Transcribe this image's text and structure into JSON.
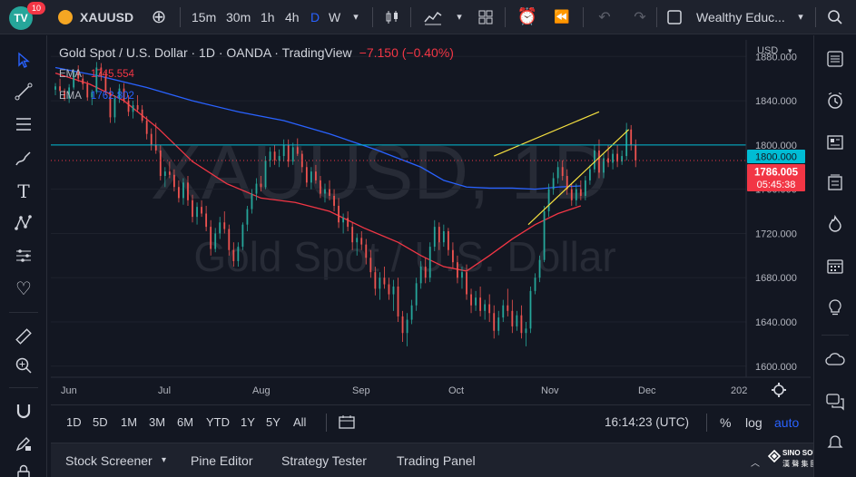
{
  "topbar": {
    "notif_count": "10",
    "symbol": "XAUUSD",
    "timeframes": [
      "15m",
      "30m",
      "1h",
      "4h",
      "D",
      "W"
    ],
    "active_timeframe": "D",
    "account": "Wealthy Educ..."
  },
  "legend": {
    "title": "Gold Spot / U.S. Dollar · 1D · OANDA · TradingView",
    "change": "−7.150 (−0.40%)",
    "ema1_label": "EMA",
    "ema1_value": "1745.554",
    "ema2_label": "EMA",
    "ema2_value": "1762.802"
  },
  "watermark": {
    "symbol": "XAUUSD, 1D",
    "name": "Gold Spot / U.S. Dollar"
  },
  "axis": {
    "currency": "USD",
    "price_ticks": [
      "1880.000",
      "1840.000",
      "1800.000",
      "1760.000",
      "1720.000",
      "1680.000",
      "1640.000",
      "1600.000"
    ],
    "date_ticks": [
      "Jun",
      "Jul",
      "Aug",
      "Sep",
      "Oct",
      "Nov",
      "Dec",
      "202"
    ],
    "level_label": "1800.000",
    "last_price": "1786.005",
    "countdown": "05:45:38"
  },
  "chart_data": {
    "type": "candlestick",
    "x_range": [
      "Jun",
      "Dec"
    ],
    "ylim": [
      1590,
      1895
    ],
    "horizontal_level": 1800,
    "last_price": 1786.005,
    "series": [
      {
        "name": "EMA 1745.554",
        "color": "#f23645",
        "points": [
          [
            0,
            1865
          ],
          [
            15,
            1855
          ],
          [
            30,
            1840
          ],
          [
            45,
            1815
          ],
          [
            60,
            1785
          ],
          [
            75,
            1765
          ],
          [
            90,
            1752
          ],
          [
            105,
            1748
          ],
          [
            120,
            1740
          ],
          [
            135,
            1725
          ],
          [
            150,
            1712
          ],
          [
            160,
            1700
          ],
          [
            170,
            1690
          ],
          [
            180,
            1686
          ],
          [
            190,
            1700
          ],
          [
            200,
            1715
          ],
          [
            210,
            1728
          ],
          [
            220,
            1738
          ],
          [
            230,
            1745
          ]
        ]
      },
      {
        "name": "EMA 1762.802",
        "color": "#2962ff",
        "points": [
          [
            0,
            1870
          ],
          [
            20,
            1862
          ],
          [
            40,
            1852
          ],
          [
            60,
            1840
          ],
          [
            80,
            1830
          ],
          [
            100,
            1822
          ],
          [
            120,
            1810
          ],
          [
            140,
            1796
          ],
          [
            160,
            1780
          ],
          [
            170,
            1768
          ],
          [
            180,
            1762
          ],
          [
            190,
            1761
          ],
          [
            200,
            1761
          ],
          [
            210,
            1760
          ],
          [
            220,
            1762
          ],
          [
            230,
            1763
          ]
        ]
      },
      {
        "name": "trend_upper",
        "color": "#f5e040",
        "points": [
          [
            192,
            1790
          ],
          [
            238,
            1830
          ]
        ]
      },
      {
        "name": "trend_lower",
        "color": "#f5e040",
        "points": [
          [
            207,
            1728
          ],
          [
            251,
            1814
          ]
        ]
      }
    ],
    "candles": [
      [
        0,
        1850,
        1856,
        1845,
        1853
      ],
      [
        2,
        1853,
        1860,
        1848,
        1849
      ],
      [
        4,
        1849,
        1851,
        1840,
        1842
      ],
      [
        6,
        1842,
        1855,
        1838,
        1852
      ],
      [
        8,
        1852,
        1868,
        1850,
        1866
      ],
      [
        10,
        1866,
        1872,
        1857,
        1860
      ],
      [
        12,
        1860,
        1864,
        1850,
        1855
      ],
      [
        14,
        1855,
        1858,
        1840,
        1843
      ],
      [
        16,
        1843,
        1850,
        1836,
        1848
      ],
      [
        18,
        1848,
        1875,
        1846,
        1870
      ],
      [
        20,
        1870,
        1874,
        1858,
        1862
      ],
      [
        22,
        1862,
        1866,
        1845,
        1848
      ],
      [
        24,
        1848,
        1852,
        1820,
        1825
      ],
      [
        26,
        1825,
        1845,
        1820,
        1842
      ],
      [
        28,
        1842,
        1855,
        1838,
        1851
      ],
      [
        30,
        1851,
        1856,
        1838,
        1840
      ],
      [
        32,
        1840,
        1845,
        1826,
        1830
      ],
      [
        34,
        1830,
        1840,
        1824,
        1836
      ],
      [
        36,
        1836,
        1845,
        1830,
        1832
      ],
      [
        38,
        1832,
        1836,
        1820,
        1822
      ],
      [
        40,
        1822,
        1826,
        1805,
        1810
      ],
      [
        42,
        1810,
        1815,
        1795,
        1800
      ],
      [
        44,
        1800,
        1820,
        1792,
        1795
      ],
      [
        46,
        1795,
        1800,
        1768,
        1772
      ],
      [
        48,
        1772,
        1780,
        1762,
        1776
      ],
      [
        50,
        1776,
        1785,
        1770,
        1773
      ],
      [
        52,
        1773,
        1778,
        1758,
        1762
      ],
      [
        54,
        1762,
        1768,
        1748,
        1752
      ],
      [
        56,
        1752,
        1770,
        1746,
        1766
      ],
      [
        58,
        1766,
        1772,
        1745,
        1750
      ],
      [
        60,
        1750,
        1755,
        1730,
        1735
      ],
      [
        62,
        1735,
        1748,
        1728,
        1744
      ],
      [
        64,
        1744,
        1750,
        1735,
        1738
      ],
      [
        66,
        1738,
        1745,
        1722,
        1726
      ],
      [
        68,
        1726,
        1732,
        1700,
        1706
      ],
      [
        70,
        1706,
        1725,
        1703,
        1720
      ],
      [
        72,
        1720,
        1735,
        1715,
        1730
      ],
      [
        74,
        1730,
        1740,
        1720,
        1724
      ],
      [
        76,
        1724,
        1728,
        1700,
        1705
      ],
      [
        78,
        1705,
        1712,
        1690,
        1695
      ],
      [
        80,
        1695,
        1712,
        1690,
        1708
      ],
      [
        82,
        1708,
        1730,
        1705,
        1728
      ],
      [
        84,
        1728,
        1745,
        1722,
        1742
      ],
      [
        86,
        1742,
        1760,
        1738,
        1756
      ],
      [
        88,
        1756,
        1770,
        1750,
        1765
      ],
      [
        90,
        1765,
        1772,
        1758,
        1762
      ],
      [
        92,
        1762,
        1790,
        1760,
        1786
      ],
      [
        94,
        1786,
        1798,
        1780,
        1794
      ],
      [
        96,
        1794,
        1800,
        1782,
        1786
      ],
      [
        98,
        1786,
        1796,
        1780,
        1790
      ],
      [
        100,
        1790,
        1805,
        1785,
        1800
      ],
      [
        102,
        1800,
        1805,
        1780,
        1785
      ],
      [
        104,
        1785,
        1802,
        1782,
        1798
      ],
      [
        106,
        1798,
        1806,
        1790,
        1792
      ],
      [
        108,
        1792,
        1795,
        1775,
        1780
      ],
      [
        110,
        1780,
        1785,
        1762,
        1766
      ],
      [
        112,
        1766,
        1780,
        1760,
        1776
      ],
      [
        114,
        1776,
        1782,
        1765,
        1768
      ],
      [
        116,
        1768,
        1772,
        1752,
        1756
      ],
      [
        118,
        1756,
        1765,
        1748,
        1760
      ],
      [
        120,
        1760,
        1768,
        1750,
        1754
      ],
      [
        122,
        1754,
        1760,
        1740,
        1745
      ],
      [
        124,
        1745,
        1752,
        1725,
        1730
      ],
      [
        126,
        1730,
        1738,
        1720,
        1734
      ],
      [
        128,
        1734,
        1740,
        1722,
        1726
      ],
      [
        130,
        1726,
        1730,
        1705,
        1712
      ],
      [
        132,
        1712,
        1720,
        1700,
        1716
      ],
      [
        134,
        1716,
        1722,
        1705,
        1710
      ],
      [
        136,
        1710,
        1715,
        1692,
        1698
      ],
      [
        138,
        1698,
        1705,
        1680,
        1685
      ],
      [
        140,
        1685,
        1690,
        1664,
        1670
      ],
      [
        142,
        1670,
        1685,
        1660,
        1680
      ],
      [
        144,
        1680,
        1690,
        1670,
        1674
      ],
      [
        146,
        1674,
        1680,
        1660,
        1665
      ],
      [
        148,
        1665,
        1678,
        1650,
        1672
      ],
      [
        150,
        1672,
        1680,
        1640,
        1645
      ],
      [
        152,
        1645,
        1650,
        1622,
        1630
      ],
      [
        154,
        1630,
        1648,
        1618,
        1642
      ],
      [
        156,
        1642,
        1660,
        1638,
        1655
      ],
      [
        158,
        1655,
        1680,
        1650,
        1675
      ],
      [
        160,
        1675,
        1695,
        1670,
        1690
      ],
      [
        162,
        1690,
        1698,
        1675,
        1680
      ],
      [
        164,
        1680,
        1712,
        1676,
        1708
      ],
      [
        166,
        1708,
        1732,
        1704,
        1726
      ],
      [
        168,
        1726,
        1730,
        1705,
        1712
      ],
      [
        170,
        1712,
        1728,
        1708,
        1722
      ],
      [
        172,
        1722,
        1725,
        1700,
        1705
      ],
      [
        174,
        1705,
        1712,
        1688,
        1694
      ],
      [
        176,
        1694,
        1700,
        1675,
        1680
      ],
      [
        178,
        1680,
        1690,
        1670,
        1685
      ],
      [
        180,
        1685,
        1692,
        1660,
        1665
      ],
      [
        182,
        1665,
        1670,
        1648,
        1655
      ],
      [
        184,
        1655,
        1668,
        1650,
        1662
      ],
      [
        186,
        1662,
        1672,
        1645,
        1650
      ],
      [
        188,
        1650,
        1660,
        1642,
        1656
      ],
      [
        190,
        1656,
        1665,
        1640,
        1648
      ],
      [
        192,
        1648,
        1655,
        1625,
        1632
      ],
      [
        194,
        1632,
        1650,
        1628,
        1644
      ],
      [
        196,
        1644,
        1660,
        1640,
        1655
      ],
      [
        198,
        1655,
        1670,
        1645,
        1650
      ],
      [
        200,
        1650,
        1660,
        1630,
        1636
      ],
      [
        202,
        1636,
        1650,
        1632,
        1646
      ],
      [
        204,
        1646,
        1655,
        1625,
        1630
      ],
      [
        206,
        1630,
        1640,
        1618,
        1634
      ],
      [
        208,
        1634,
        1672,
        1630,
        1668
      ],
      [
        210,
        1668,
        1684,
        1665,
        1680
      ],
      [
        212,
        1680,
        1700,
        1676,
        1696
      ],
      [
        214,
        1696,
        1745,
        1694,
        1740
      ],
      [
        216,
        1740,
        1765,
        1735,
        1760
      ],
      [
        218,
        1760,
        1775,
        1755,
        1770
      ],
      [
        220,
        1770,
        1785,
        1765,
        1780
      ],
      [
        222,
        1780,
        1786,
        1768,
        1772
      ],
      [
        224,
        1772,
        1778,
        1755,
        1760
      ],
      [
        226,
        1760,
        1765,
        1745,
        1750
      ],
      [
        228,
        1750,
        1765,
        1745,
        1760
      ],
      [
        230,
        1760,
        1768,
        1750,
        1754
      ],
      [
        232,
        1754,
        1772,
        1750,
        1768
      ],
      [
        234,
        1768,
        1782,
        1764,
        1778
      ],
      [
        236,
        1778,
        1800,
        1775,
        1795
      ],
      [
        238,
        1795,
        1805,
        1770,
        1775
      ],
      [
        240,
        1775,
        1792,
        1770,
        1788
      ],
      [
        242,
        1788,
        1800,
        1780,
        1784
      ],
      [
        244,
        1784,
        1796,
        1778,
        1792
      ],
      [
        246,
        1792,
        1800,
        1780,
        1785
      ],
      [
        248,
        1785,
        1795,
        1782,
        1790
      ],
      [
        250,
        1790,
        1820,
        1786,
        1814
      ],
      [
        252,
        1814,
        1818,
        1795,
        1800
      ],
      [
        254,
        1800,
        1805,
        1780,
        1786
      ]
    ]
  },
  "range_bar": {
    "ranges": [
      "1D",
      "5D",
      "1M",
      "3M",
      "6M",
      "YTD",
      "1Y",
      "5Y",
      "All"
    ],
    "clock": "16:14:23 (UTC)",
    "percent": "%",
    "log": "log",
    "auto": "auto"
  },
  "panel_bar": {
    "tabs": [
      "Stock Screener",
      "Pine Editor",
      "Strategy Tester",
      "Trading Panel"
    ]
  },
  "brand": {
    "name": "SINO SOUND",
    "sub": "漢 聲 集 團"
  },
  "colors": {
    "up": "#26a69a",
    "down": "#ef5350",
    "level": "#00bcd4",
    "price_label": "#f23645",
    "accent": "#2962ff"
  }
}
